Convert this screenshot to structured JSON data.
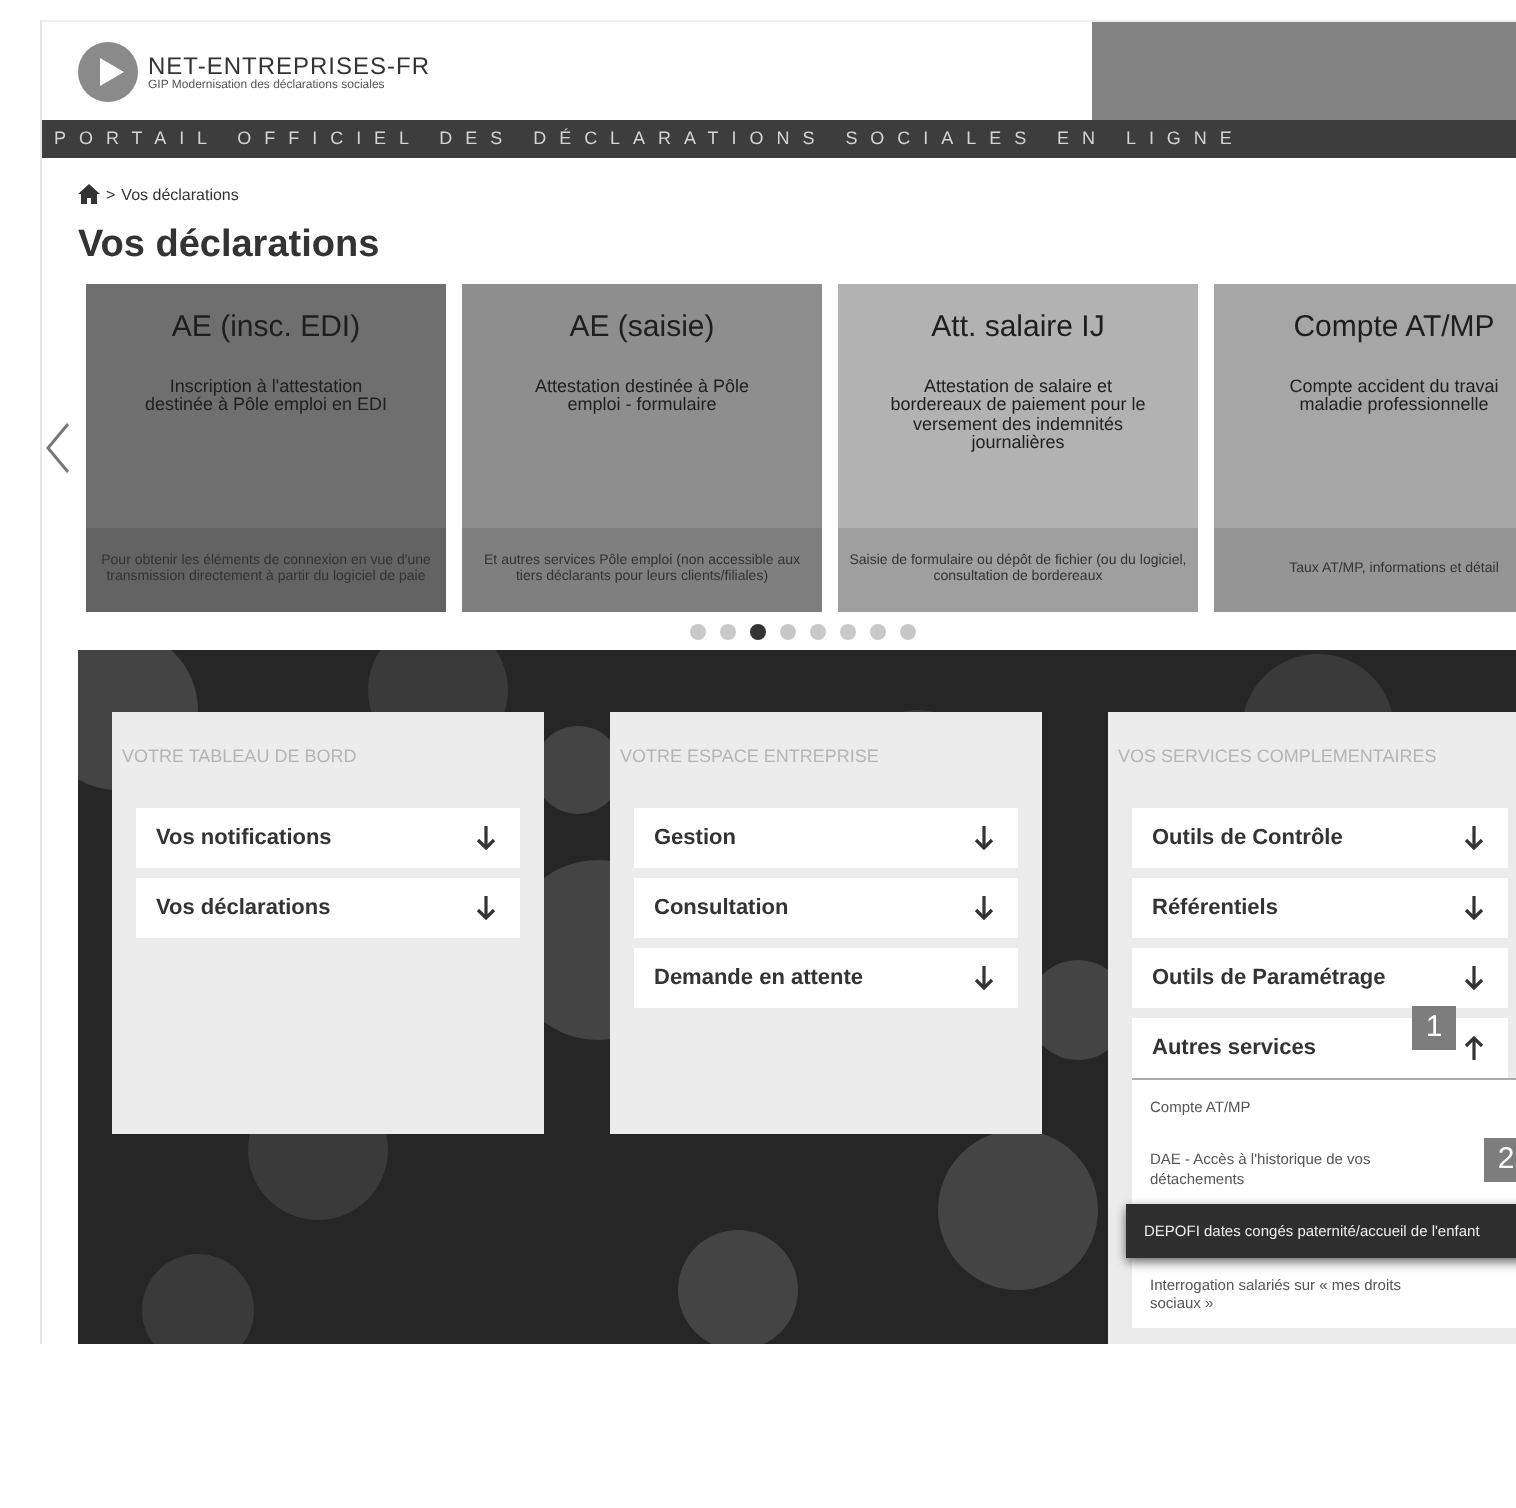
{
  "header": {
    "logo_title": "NET-ENTREPRISES-FR",
    "logo_subtitle": "GIP Modernisation des déclarations sociales",
    "tagline": "PORTAIL OFFICIEL DES DÉCLARATIONS SOCIALES EN LIGNE"
  },
  "breadcrumb": {
    "separator": ">",
    "current": "Vos déclarations"
  },
  "page_title": "Vos déclarations",
  "carousel": {
    "cards": [
      {
        "title": "AE (insc. EDI)",
        "description": "Inscription à l'attestation destinée à Pôle emploi en EDI",
        "footer": "Pour obtenir les éléments de connexion en vue d'une transmission directement à partir du logiciel de paie",
        "color": "#6f6f6f"
      },
      {
        "title": "AE (saisie)",
        "description": "Attestation destinée à Pôle emploi - formulaire",
        "footer": "Et autres services Pôle emploi (non accessible aux tiers déclarants pour leurs clients/filiales)",
        "color": "#8e8e8e"
      },
      {
        "title": "Att. salaire IJ",
        "description": "Attestation de salaire et bordereaux de paiement pour le versement des indemnités journalières",
        "footer": "Saisie de formulaire ou dépôt de fichier (ou du logiciel, consultation de bordereaux",
        "color": "#b2b2b2"
      },
      {
        "title": "Compte AT/MP",
        "description": "Compte accident du travai\nmaladie professionnelle",
        "footer": "Taux AT/MP, informations et détail",
        "color": "#a6a6a6"
      }
    ],
    "dots": [
      {
        "selected": false
      },
      {
        "selected": false
      },
      {
        "selected": true
      },
      {
        "selected": false
      },
      {
        "selected": false
      },
      {
        "selected": false
      },
      {
        "selected": false
      },
      {
        "selected": false
      }
    ]
  },
  "panels": [
    {
      "title": "VOTRE TABLEAU DE BORD",
      "items": [
        {
          "label": "Vos notifications",
          "expanded": false
        },
        {
          "label": "Vos déclarations",
          "expanded": false
        }
      ]
    },
    {
      "title": "VOTRE ESPACE ENTREPRISE",
      "items": [
        {
          "label": "Gestion",
          "expanded": false
        },
        {
          "label": "Consultation",
          "expanded": false
        },
        {
          "label": "Demande en attente",
          "expanded": false
        }
      ]
    },
    {
      "title": "VOS SERVICES COMPLEMENTAIRES",
      "items": [
        {
          "label": "Outils de Contrôle",
          "expanded": false
        },
        {
          "label": "Référentiels",
          "expanded": false
        },
        {
          "label": "Outils de Paramétrage",
          "expanded": false
        },
        {
          "label": "Autres services",
          "expanded": true,
          "badge": "1",
          "children": [
            {
              "label": "Compte AT/MP",
              "selected": false
            },
            {
              "label": "DAE - Accès à l'historique de vos détachements",
              "selected": false,
              "badge": "2"
            },
            {
              "label": "DEPOFI dates congés paternité/accueil de l'enfant",
              "selected": true
            },
            {
              "label": "Interrogation salariés sur « mes droits sociaux »",
              "selected": false
            }
          ]
        }
      ]
    }
  ]
}
